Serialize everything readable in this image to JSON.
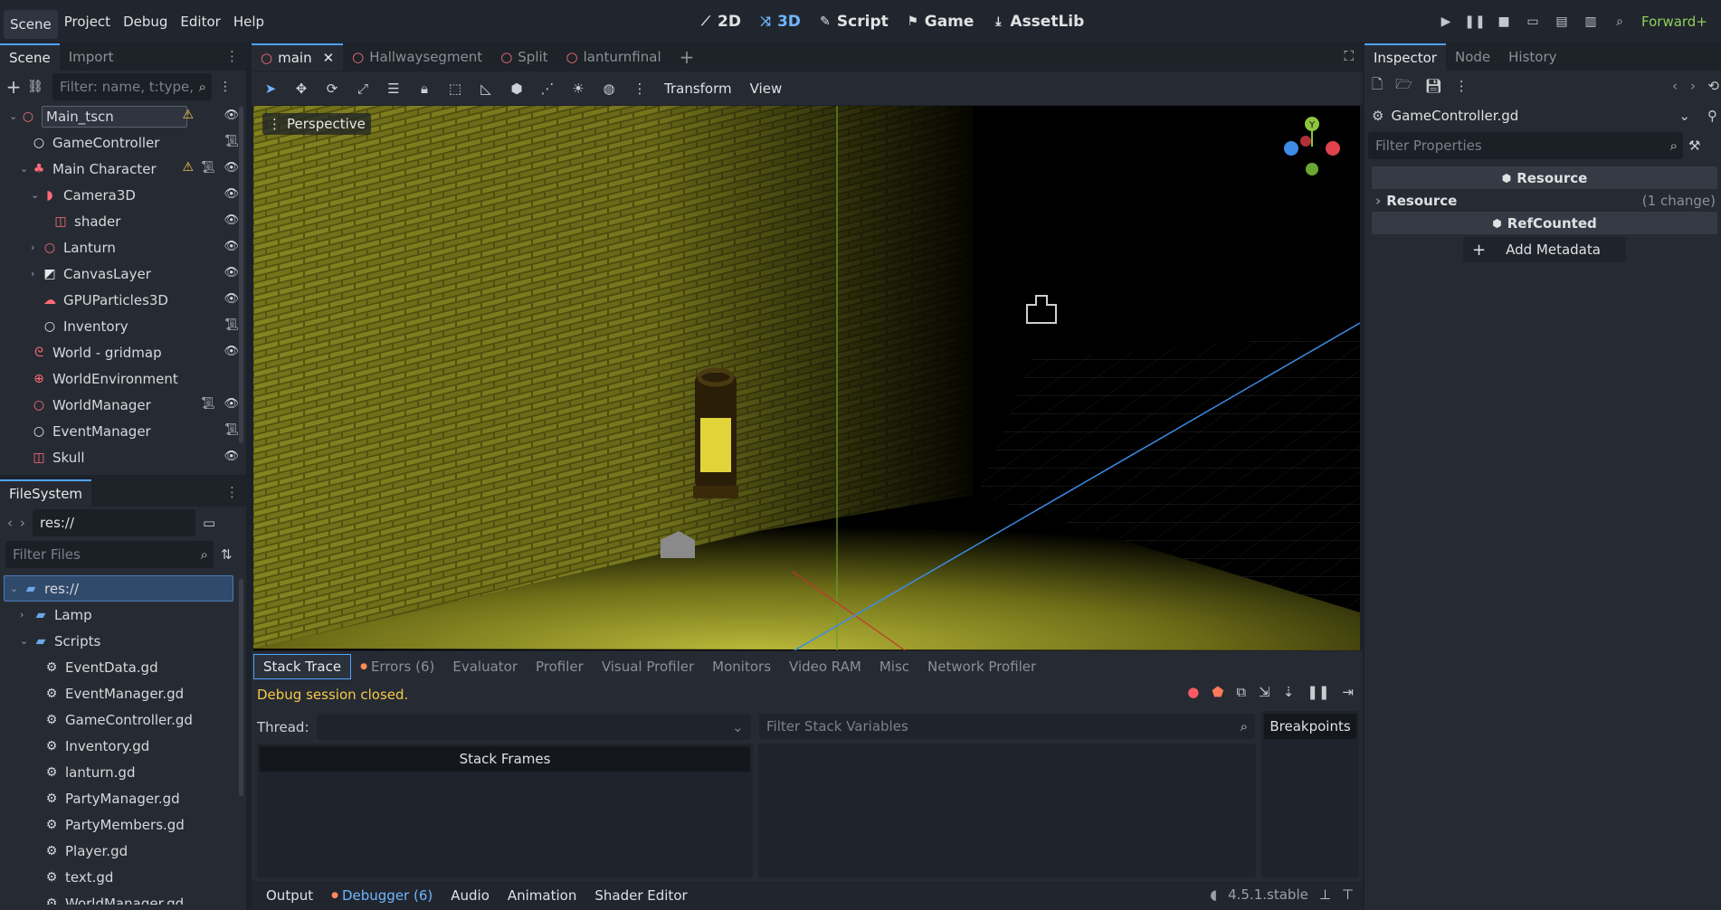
{
  "menu": [
    "Scene",
    "Project",
    "Debug",
    "Editor",
    "Help"
  ],
  "modes": [
    {
      "icon": "2d-icon",
      "label": "2D"
    },
    {
      "icon": "3d-icon",
      "label": "3D"
    },
    {
      "icon": "script-icon",
      "label": "Script"
    },
    {
      "icon": "game-icon",
      "label": "Game"
    },
    {
      "icon": "assetlib-icon",
      "label": "AssetLib"
    }
  ],
  "renderer": "Forward+",
  "scene_dock": {
    "tabs": [
      "Scene",
      "Import"
    ],
    "filter_placeholder": "Filter: name, t:type,",
    "nodes": [
      {
        "name": "Main_tscn",
        "depth": 0,
        "arrow": "v",
        "icon": "node3d-icon",
        "warn": true,
        "script": false,
        "eye": true,
        "selected": true
      },
      {
        "name": "GameController",
        "depth": 1,
        "arrow": "",
        "icon": "node-icon",
        "warn": false,
        "script": true,
        "eye": false
      },
      {
        "name": "Main Character",
        "depth": 1,
        "arrow": "v",
        "icon": "character-icon",
        "warn": true,
        "script": true,
        "eye": true
      },
      {
        "name": "Camera3D",
        "depth": 2,
        "arrow": "v",
        "icon": "camera-icon",
        "warn": false,
        "script": false,
        "eye": true
      },
      {
        "name": "shader",
        "depth": 3,
        "arrow": "",
        "icon": "colorrect-icon",
        "warn": false,
        "script": false,
        "eye": true
      },
      {
        "name": "Lanturn",
        "depth": 2,
        "arrow": ">",
        "icon": "node3d-icon",
        "warn": false,
        "script": false,
        "eye": true
      },
      {
        "name": "CanvasLayer",
        "depth": 2,
        "arrow": ">",
        "icon": "canvaslayer-icon",
        "warn": false,
        "script": false,
        "eye": true
      },
      {
        "name": "GPUParticles3D",
        "depth": 2,
        "arrow": "",
        "icon": "particles-icon",
        "warn": false,
        "script": false,
        "eye": true
      },
      {
        "name": "Inventory",
        "depth": 2,
        "arrow": "",
        "icon": "node-icon",
        "warn": false,
        "script": true,
        "eye": false
      },
      {
        "name": "World - gridmap",
        "depth": 1,
        "arrow": "",
        "icon": "gridmap-icon",
        "warn": false,
        "script": false,
        "eye": true
      },
      {
        "name": "WorldEnvironment",
        "depth": 1,
        "arrow": "",
        "icon": "environment-icon",
        "warn": false,
        "script": false,
        "eye": false
      },
      {
        "name": "WorldManager",
        "depth": 1,
        "arrow": "",
        "icon": "node3d-icon",
        "warn": false,
        "script": true,
        "eye": true
      },
      {
        "name": "EventManager",
        "depth": 1,
        "arrow": "",
        "icon": "node-icon",
        "warn": false,
        "script": true,
        "eye": false
      },
      {
        "name": "Skull",
        "depth": 1,
        "arrow": "",
        "icon": "sprite3d-icon",
        "warn": false,
        "script": false,
        "eye": true
      }
    ]
  },
  "filesystem": {
    "tab": "FileSystem",
    "path": "res://",
    "filter_placeholder": "Filter Files",
    "items": [
      {
        "name": "res://",
        "depth": 0,
        "type": "folder",
        "arrow": "v",
        "selected": true
      },
      {
        "name": "Lamp",
        "depth": 1,
        "type": "folder",
        "arrow": ">"
      },
      {
        "name": "Scripts",
        "depth": 1,
        "type": "folder",
        "arrow": "v"
      },
      {
        "name": "EventData.gd",
        "depth": 2,
        "type": "gd"
      },
      {
        "name": "EventManager.gd",
        "depth": 2,
        "type": "gd"
      },
      {
        "name": "GameController.gd",
        "depth": 2,
        "type": "gd"
      },
      {
        "name": "Inventory.gd",
        "depth": 2,
        "type": "gd"
      },
      {
        "name": "lanturn.gd",
        "depth": 2,
        "type": "gd"
      },
      {
        "name": "PartyManager.gd",
        "depth": 2,
        "type": "gd"
      },
      {
        "name": "PartyMembers.gd",
        "depth": 2,
        "type": "gd"
      },
      {
        "name": "Player.gd",
        "depth": 2,
        "type": "gd"
      },
      {
        "name": "text.gd",
        "depth": 2,
        "type": "gd"
      },
      {
        "name": "WorldManager.gd",
        "depth": 2,
        "type": "gd"
      }
    ]
  },
  "scene_tabs": [
    "main",
    "Hallwaysegment",
    "Split",
    "lanturnfinal"
  ],
  "viewport": {
    "menus": [
      "Transform",
      "View"
    ],
    "perspective": "Perspective",
    "gizmo_y": "Y"
  },
  "debugger": {
    "tabs": [
      "Stack Trace",
      "Errors (6)",
      "Evaluator",
      "Profiler",
      "Visual Profiler",
      "Monitors",
      "Video RAM",
      "Misc",
      "Network Profiler"
    ],
    "status": "Debug session closed.",
    "thread_label": "Thread:",
    "filter_placeholder": "Filter Stack Variables",
    "breakpoints": "Breakpoints",
    "stack_frames": "Stack Frames"
  },
  "bottom_tabs": [
    "Output",
    "Debugger (6)",
    "Audio",
    "Animation",
    "Shader Editor"
  ],
  "version": "4.5.1.stable",
  "inspector": {
    "tabs": [
      "Inspector",
      "Node",
      "History"
    ],
    "object": "GameController.gd",
    "filter_placeholder": "Filter Properties",
    "section_resource": "Resource",
    "prop_name": "Resource",
    "prop_value": "(1 change)",
    "section_refcounted": "RefCounted",
    "add_metadata": "Add Metadata"
  },
  "colors": {
    "accent": "#4fa3ff",
    "warn": "#f7c948",
    "error": "#ff6b78",
    "status": "#f7c948"
  }
}
